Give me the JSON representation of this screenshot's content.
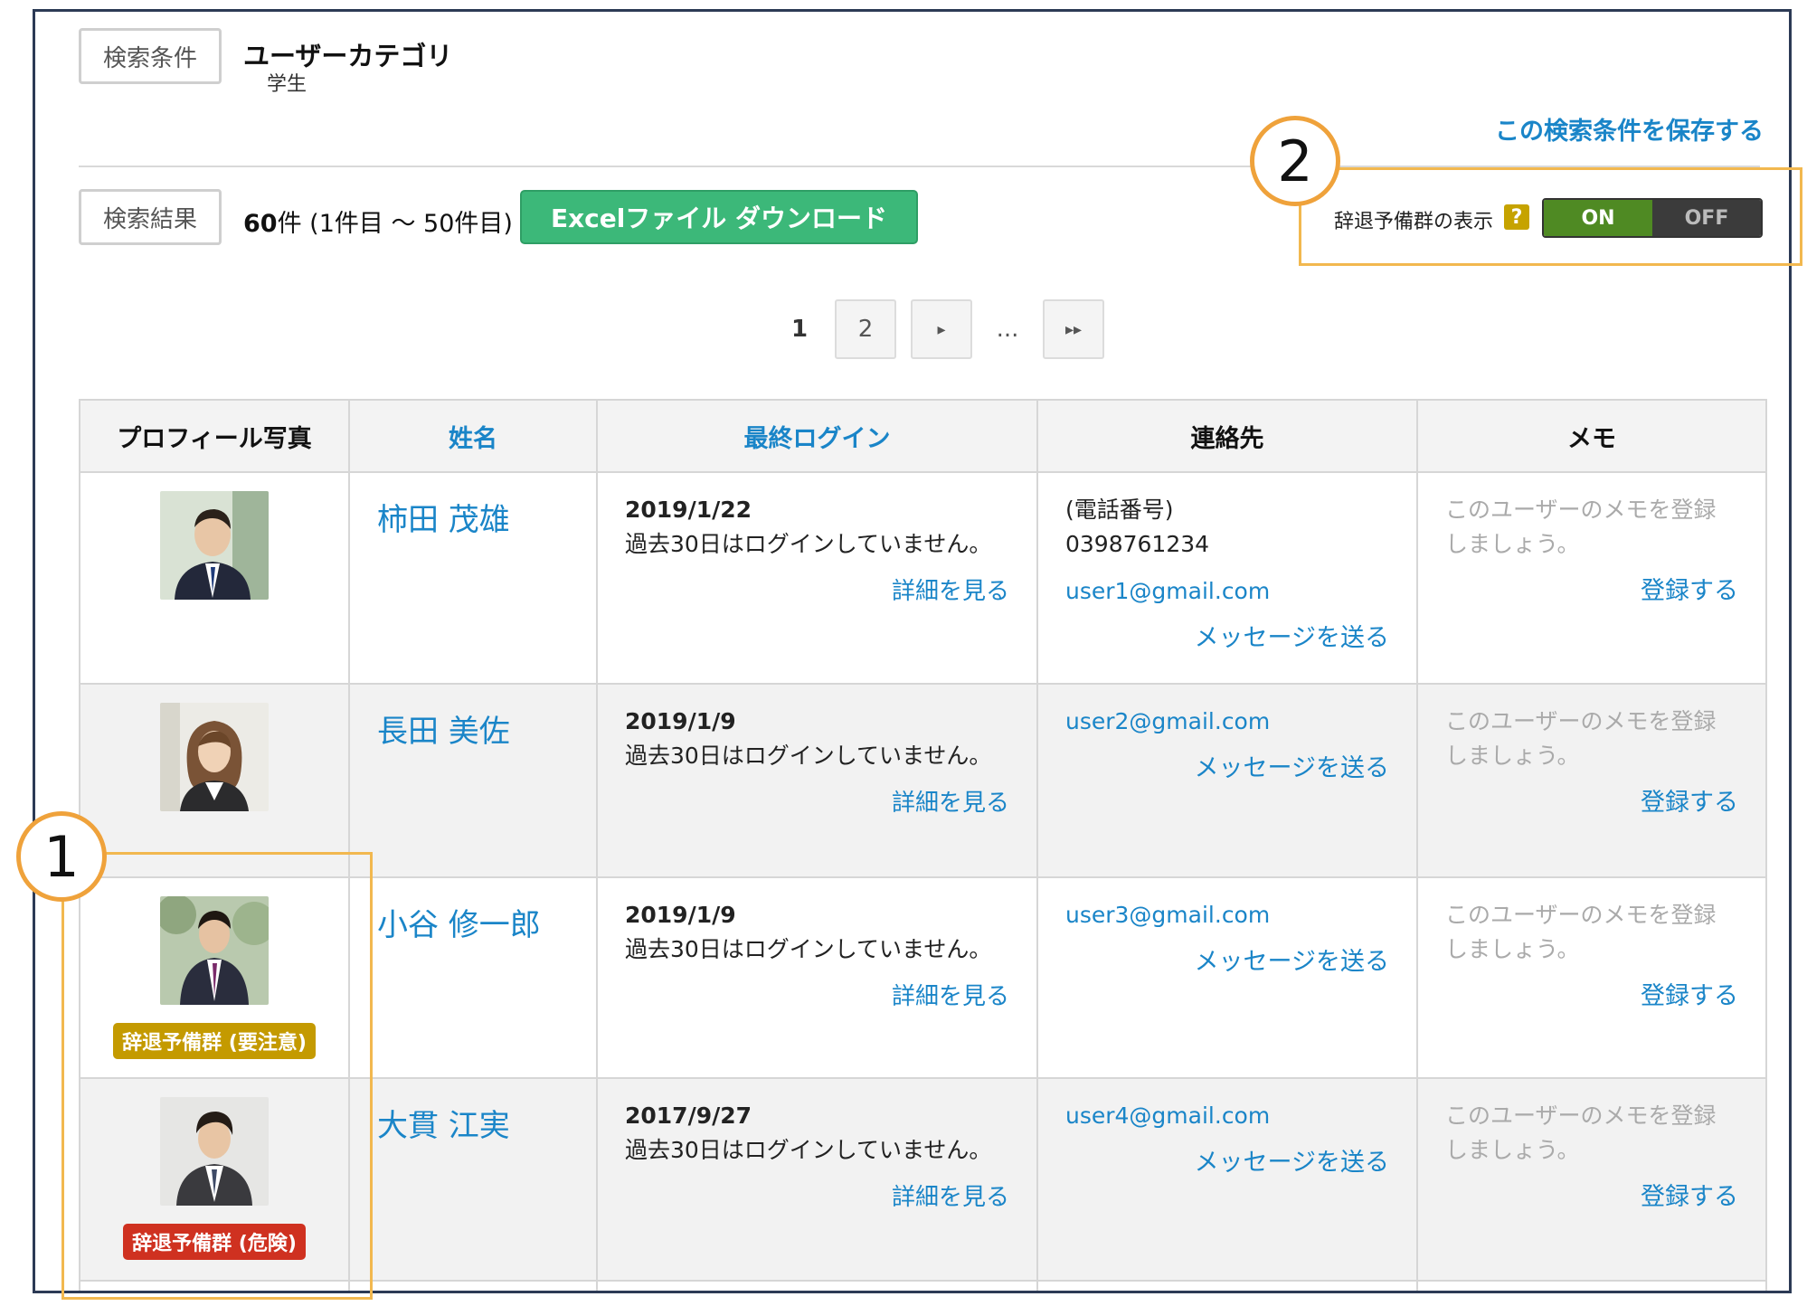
{
  "search": {
    "condition_tag": "検索条件",
    "category_title": "ユーザーカテゴリ",
    "category_value": "学生",
    "save_link": "この検索条件を保存する"
  },
  "results": {
    "tag": "検索結果",
    "count_strong": "60",
    "count_text": "件 (1件目 〜 50件目)",
    "excel_button": "Excelファイル ダウンロード"
  },
  "toggle": {
    "label": "辞退予備群の表示",
    "help": "?",
    "on": "ON",
    "off": "OFF"
  },
  "pagination": {
    "current": "1",
    "page2": "2",
    "next": "▸",
    "ellipsis": "...",
    "last": "▸▸"
  },
  "table": {
    "headers": [
      "プロフィール写真",
      "姓名",
      "最終ログイン",
      "連絡先",
      "メモ"
    ],
    "rows": [
      {
        "name": "柿田 茂雄",
        "login_date": "2019/1/22",
        "login_note": "過去30日はログインしていません。",
        "detail": "詳細を見る",
        "phone_label": "(電話番号)",
        "phone": "0398761234",
        "email": "user1@gmail.com",
        "message": "メッセージを送る",
        "memo": "このユーザーのメモを登録しましょう。",
        "register": "登録する",
        "badge": ""
      },
      {
        "name": "長田 美佐",
        "login_date": "2019/1/9",
        "login_note": "過去30日はログインしていません。",
        "detail": "詳細を見る",
        "email": "user2@gmail.com",
        "message": "メッセージを送る",
        "memo": "このユーザーのメモを登録しましょう。",
        "register": "登録する",
        "badge": ""
      },
      {
        "name": "小谷 修一郎",
        "login_date": "2019/1/9",
        "login_note": "過去30日はログインしていません。",
        "detail": "詳細を見る",
        "email": "user3@gmail.com",
        "message": "メッセージを送る",
        "memo": "このユーザーのメモを登録しましょう。",
        "register": "登録する",
        "badge": "辞退予備群 (要注意)"
      },
      {
        "name": "大貫 江実",
        "login_date": "2017/9/27",
        "login_note": "過去30日はログインしていません。",
        "detail": "詳細を見る",
        "email": "user4@gmail.com",
        "message": "メッセージを送る",
        "memo": "このユーザーのメモを登録しましょう。",
        "register": "登録する",
        "badge": "辞退予備群 (危険)"
      }
    ]
  },
  "callouts": {
    "one": "1",
    "two": "2"
  },
  "colors": {
    "link": "#1a85c8",
    "excel_button": "#3cb879",
    "toggle_on": "#4f8a23",
    "badge_warning": "#c49a00",
    "badge_danger": "#cf3120",
    "callout": "#efa23b"
  }
}
